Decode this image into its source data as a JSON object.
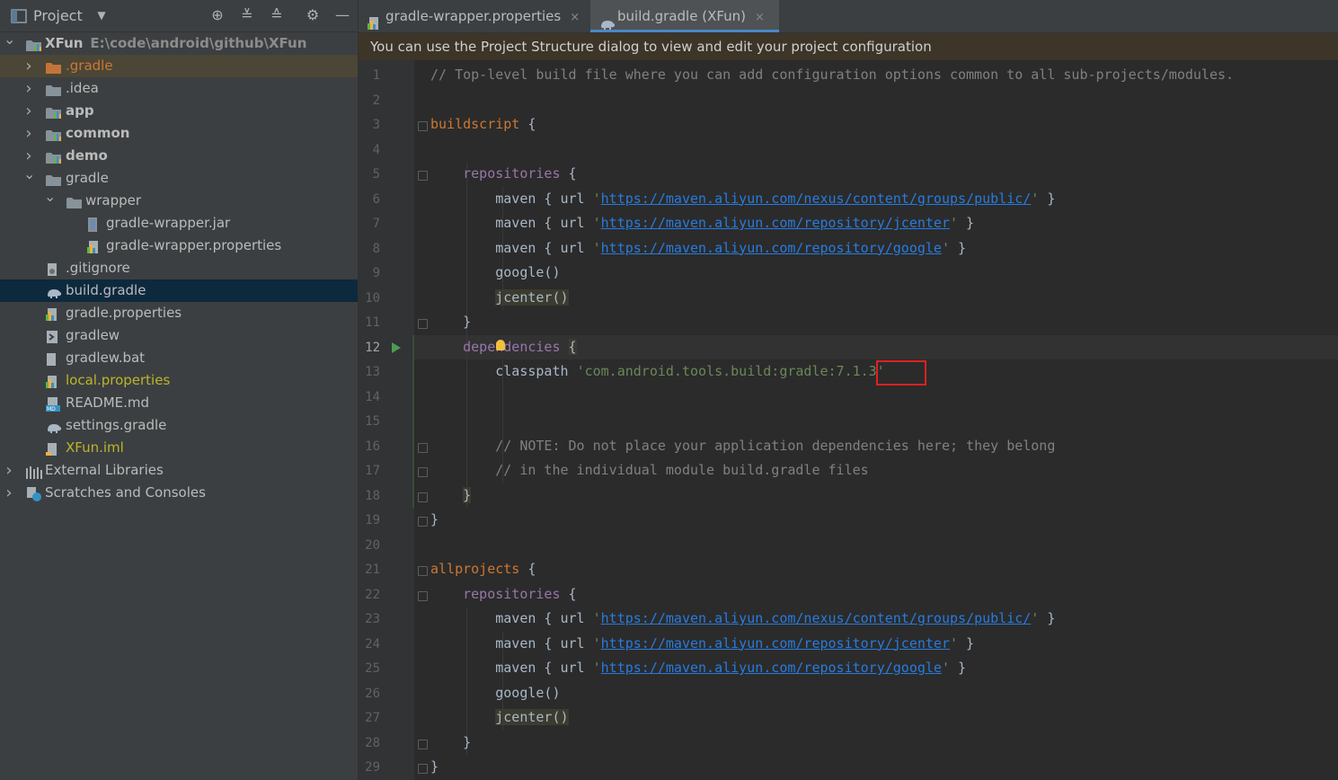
{
  "project_panel": {
    "title": "Project",
    "header_icons": [
      "locate-icon",
      "expand-all-icon",
      "collapse-all-icon",
      "gear-icon",
      "minimize-icon"
    ],
    "tree": [
      {
        "label": "XFun",
        "sub": "E:\\code\\android\\github\\XFun",
        "icon": "module-icon",
        "level": 0,
        "arrow": "down",
        "bold": true
      },
      {
        "label": ".gradle",
        "icon": "folder-orange-icon",
        "level": 1,
        "arrow": "right",
        "color": "#cc7832",
        "highlight": true
      },
      {
        "label": ".idea",
        "icon": "folder-icon",
        "level": 1,
        "arrow": "right"
      },
      {
        "label": "app",
        "icon": "module-icon",
        "level": 1,
        "arrow": "right",
        "bold": true
      },
      {
        "label": "common",
        "icon": "module-icon",
        "level": 1,
        "arrow": "right",
        "bold": true
      },
      {
        "label": "demo",
        "icon": "module-icon",
        "level": 1,
        "arrow": "right",
        "bold": true
      },
      {
        "label": "gradle",
        "icon": "folder-icon",
        "level": 1,
        "arrow": "down"
      },
      {
        "label": "wrapper",
        "icon": "folder-icon",
        "level": 2,
        "arrow": "down"
      },
      {
        "label": "gradle-wrapper.jar",
        "icon": "jar-icon",
        "level": 3
      },
      {
        "label": "gradle-wrapper.properties",
        "icon": "properties-icon",
        "level": 3
      },
      {
        "label": ".gitignore",
        "icon": "gitignore-icon",
        "level": 1
      },
      {
        "label": "build.gradle",
        "icon": "gradle-elephant-icon",
        "level": 1,
        "selected": true
      },
      {
        "label": "gradle.properties",
        "icon": "properties-icon",
        "level": 1
      },
      {
        "label": "gradlew",
        "icon": "shell-icon",
        "level": 1
      },
      {
        "label": "gradlew.bat",
        "icon": "file-icon",
        "level": 1
      },
      {
        "label": "local.properties",
        "icon": "properties-icon",
        "level": 1,
        "color": "#bbb529"
      },
      {
        "label": "README.md",
        "icon": "markdown-icon",
        "level": 1
      },
      {
        "label": "settings.gradle",
        "icon": "gradle-elephant-icon",
        "level": 1
      },
      {
        "label": "XFun.iml",
        "icon": "iml-icon",
        "level": 1,
        "color": "#bbb529"
      },
      {
        "label": "External Libraries",
        "icon": "libraries-icon",
        "level": 0,
        "arrow": "right"
      },
      {
        "label": "Scratches and Consoles",
        "icon": "scratches-icon",
        "level": 0,
        "arrow": "right"
      }
    ]
  },
  "tabs": [
    {
      "label": "gradle-wrapper.properties",
      "icon": "properties-icon",
      "active": false
    },
    {
      "label": "build.gradle (XFun)",
      "icon": "gradle-elephant-icon",
      "active": true
    }
  ],
  "close_glyph": "×",
  "banner": {
    "text": "You can use the Project Structure dialog to view and edit your project configuration"
  },
  "editor": {
    "current_line": 12,
    "lines": [
      [
        [
          "cmt",
          "// Top-level build file where you can add configuration options common to all sub-projects/modules."
        ]
      ],
      [],
      [
        [
          "kw",
          "buildscript"
        ],
        [
          "",
          " {"
        ]
      ],
      [],
      [
        [
          "",
          "    "
        ],
        [
          "fn",
          "repositories"
        ],
        [
          "",
          " {"
        ]
      ],
      [
        [
          "",
          "        maven { url "
        ],
        [
          "str",
          "'"
        ],
        [
          "url",
          "https://maven.aliyun.com/nexus/content/groups/public/"
        ],
        [
          "str",
          "'"
        ],
        [
          "",
          " }"
        ]
      ],
      [
        [
          "",
          "        maven { url "
        ],
        [
          "str",
          "'"
        ],
        [
          "url",
          "https://maven.aliyun.com/repository/jcenter"
        ],
        [
          "str",
          "'"
        ],
        [
          "",
          " }"
        ]
      ],
      [
        [
          "",
          "        maven { url "
        ],
        [
          "str",
          "'"
        ],
        [
          "url",
          "https://maven.aliyun.com/repository/google"
        ],
        [
          "str",
          "'"
        ],
        [
          "",
          " }"
        ]
      ],
      [
        [
          "",
          "        google()"
        ]
      ],
      [
        [
          "",
          "        "
        ],
        [
          "mark",
          "jcenter()"
        ]
      ],
      [
        [
          "",
          "    }"
        ]
      ],
      [
        [
          "",
          "    "
        ],
        [
          "fn",
          "dependencies"
        ],
        [
          "",
          " "
        ],
        [
          "mark",
          "{"
        ]
      ],
      [
        [
          "",
          "        classpath "
        ],
        [
          "str",
          "'com.android.tools.build:gradle:7.1.3'"
        ]
      ],
      [],
      [],
      [
        [
          "",
          "        "
        ],
        [
          "cmt",
          "// NOTE: Do not place your application dependencies here; they belong"
        ]
      ],
      [
        [
          "",
          "        "
        ],
        [
          "cmt",
          "// in the individual module build.gradle files"
        ]
      ],
      [
        [
          "",
          "    "
        ],
        [
          "mark",
          "}"
        ]
      ],
      [
        [
          "",
          "}"
        ]
      ],
      [],
      [
        [
          "kw",
          "allprojects"
        ],
        [
          "",
          " {"
        ]
      ],
      [
        [
          "",
          "    "
        ],
        [
          "fn",
          "repositories"
        ],
        [
          "",
          " {"
        ]
      ],
      [
        [
          "",
          "        maven { url "
        ],
        [
          "str",
          "'"
        ],
        [
          "url",
          "https://maven.aliyun.com/nexus/content/groups/public/"
        ],
        [
          "str",
          "'"
        ],
        [
          "",
          " }"
        ]
      ],
      [
        [
          "",
          "        maven { url "
        ],
        [
          "str",
          "'"
        ],
        [
          "url",
          "https://maven.aliyun.com/repository/jcenter"
        ],
        [
          "str",
          "'"
        ],
        [
          "",
          " }"
        ]
      ],
      [
        [
          "",
          "        maven { url "
        ],
        [
          "str",
          "'"
        ],
        [
          "url",
          "https://maven.aliyun.com/repository/google"
        ],
        [
          "str",
          "'"
        ],
        [
          "",
          " }"
        ]
      ],
      [
        [
          "",
          "        google()"
        ]
      ],
      [
        [
          "",
          "        "
        ],
        [
          "mark",
          "jcenter()"
        ]
      ],
      [
        [
          "",
          "    }"
        ]
      ],
      [
        [
          "",
          "}"
        ]
      ]
    ],
    "highlighted_token": "7.1.3"
  }
}
